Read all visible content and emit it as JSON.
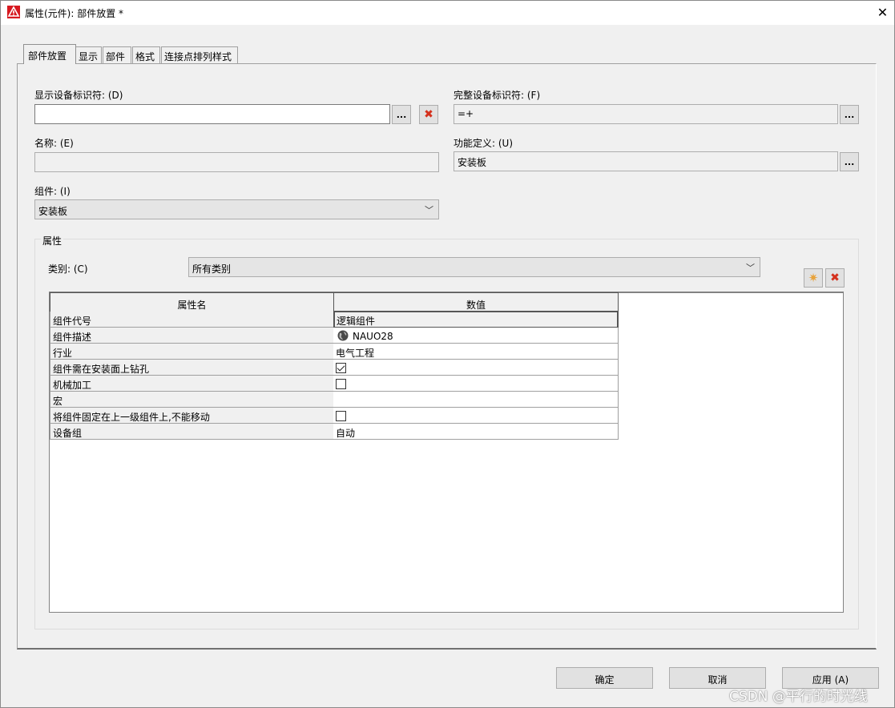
{
  "window": {
    "title": "属性(元件): 部件放置 *",
    "close_glyph": "✕"
  },
  "tabs": [
    "部件放置",
    "显示",
    "部件",
    "格式",
    "连接点排列样式"
  ],
  "fields": {
    "display_id_label": "显示设备标识符: (D)",
    "display_id_value": "",
    "full_id_label": "完整设备标识符: (F)",
    "full_id_value": "=+",
    "name_label": "名称: (E)",
    "name_value": "",
    "function_label": "功能定义: (U)",
    "function_value": "安装板",
    "component_label": "组件: (I)",
    "component_value": "安装板",
    "more_button": "..."
  },
  "properties": {
    "group_title": "属性",
    "category_label": "类别: (C)",
    "category_value": "所有类别",
    "columns": [
      "属性名",
      "数值"
    ],
    "rows": [
      {
        "name": "组件代号",
        "value": "逻辑组件"
      },
      {
        "name": "组件描述",
        "value": "NAUO28"
      },
      {
        "name": "行业",
        "value": "电气工程"
      },
      {
        "name": "组件需在安装面上钻孔",
        "checked": true
      },
      {
        "name": "机械加工",
        "checked": false
      },
      {
        "name": "宏",
        "value": ""
      },
      {
        "name": "将组件固定在上一级组件上,不能移动",
        "checked": false
      },
      {
        "name": "设备组",
        "value": "自动"
      }
    ]
  },
  "buttons": {
    "ok": "确定",
    "cancel": "取消",
    "apply": "应用 (A)"
  },
  "watermark": "CSDN @平行的时光线",
  "colors": {
    "accent_red": "#d4301c",
    "new_star": "#e8a23a",
    "dialog_bg": "#f0f0f0"
  },
  "icons": {
    "app": "eplan-warning-triangle-icon",
    "delete": "red-x-icon",
    "new": "star-icon",
    "globe": "globe-icon",
    "dropdown": "chevron-down-icon"
  }
}
